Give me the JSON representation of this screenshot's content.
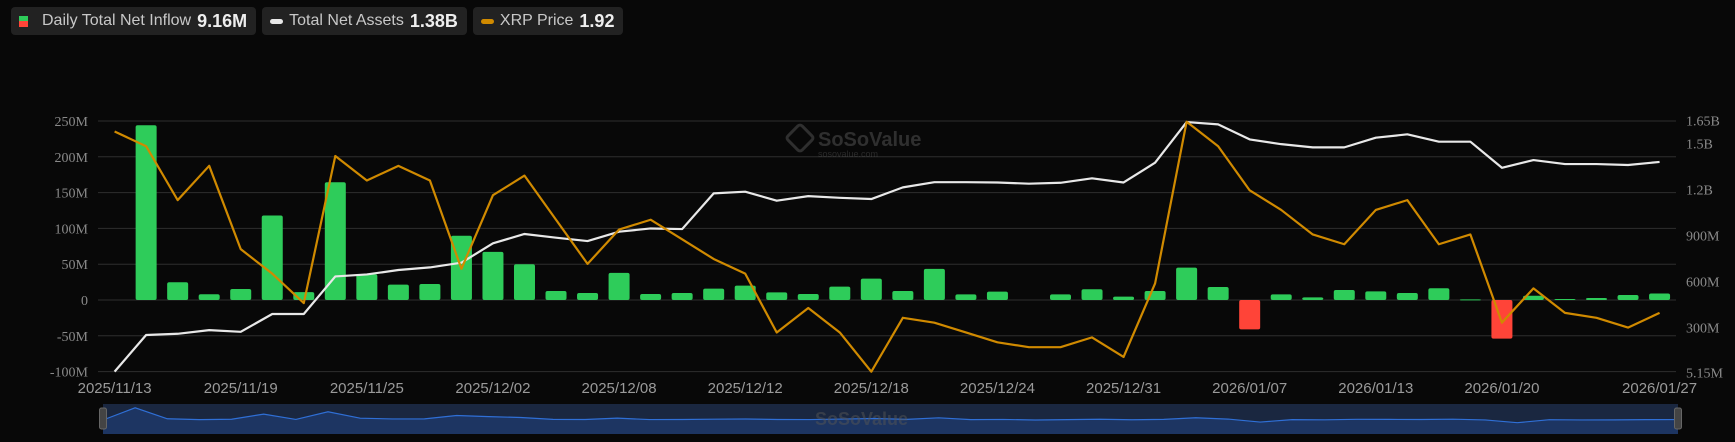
{
  "legend": [
    {
      "label": "Daily Total Net Inflow",
      "value": "9.16M",
      "color_up": "#2ecc5a",
      "color_down": "#ff4438"
    },
    {
      "label": "Total Net Assets",
      "value": "1.38B",
      "color": "#e8e8e8"
    },
    {
      "label": "XRP Price",
      "value": "1.92",
      "color": "#d08a00"
    }
  ],
  "watermark": {
    "brand": "SoSoValue",
    "url": "sosovalue.com"
  },
  "chart_data": {
    "type": "bar+line",
    "x": [
      "2025/11/13",
      "2025/11/14",
      "2025/11/17",
      "2025/11/18",
      "2025/11/19",
      "2025/11/20",
      "2025/11/21",
      "2025/11/24",
      "2025/11/25",
      "2025/11/26",
      "2025/11/28",
      "2025/12/01",
      "2025/12/02",
      "2025/12/03",
      "2025/12/04",
      "2025/12/05",
      "2025/12/08",
      "2025/12/09",
      "2025/12/10",
      "2025/12/11",
      "2025/12/12",
      "2025/12/15",
      "2025/12/16",
      "2025/12/17",
      "2025/12/18",
      "2025/12/19",
      "2025/12/22",
      "2025/12/23",
      "2025/12/24",
      "2025/12/26",
      "2025/12/29",
      "2025/12/30",
      "2025/12/31",
      "2026/01/02",
      "2026/01/05",
      "2026/01/06",
      "2026/01/07",
      "2026/01/08",
      "2026/01/09",
      "2026/01/12",
      "2026/01/13",
      "2026/01/14",
      "2026/01/15",
      "2026/01/16",
      "2026/01/20",
      "2026/01/21",
      "2026/01/22",
      "2026/01/23",
      "2026/01/26",
      "2026/01/27"
    ],
    "x_tick_labels": [
      "2025/11/13",
      "2025/11/19",
      "2025/11/25",
      "2025/12/02",
      "2025/12/08",
      "2025/12/12",
      "2025/12/18",
      "2025/12/24",
      "2025/12/31",
      "2026/01/07",
      "2026/01/13",
      "2026/01/20",
      "2026/01/27"
    ],
    "series": [
      {
        "name": "Daily Total Net Inflow",
        "type": "bar",
        "axis": "left",
        "unit": "M USD",
        "values": [
          0,
          244,
          24.8,
          8,
          15.4,
          118,
          11,
          164.5,
          36,
          21.5,
          22.4,
          89.7,
          67.3,
          50,
          12.6,
          9.8,
          37.9,
          8.4,
          9.8,
          15.9,
          20.1,
          10.7,
          8.4,
          18.7,
          29.9,
          12.6,
          43.5,
          7.9,
          11.7,
          0,
          7.9,
          15,
          4.7,
          12.6,
          45.3,
          18.2,
          -41,
          7.9,
          3.7,
          14,
          12.1,
          9.8,
          16.4,
          0.9,
          -54,
          6,
          1.4,
          2.8,
          7,
          9.16
        ]
      },
      {
        "name": "Total Net Assets",
        "type": "line",
        "axis": "right",
        "unit": "M USD",
        "values": [
          12,
          251,
          259,
          283,
          272,
          388,
          388,
          633,
          646,
          675,
          692,
          723,
          849,
          910,
          886,
          864,
          925,
          946,
          942,
          1175,
          1186,
          1127,
          1157,
          1146,
          1138,
          1214,
          1248,
          1248,
          1246,
          1238,
          1244,
          1273,
          1246,
          1375,
          1640,
          1625,
          1527,
          1496,
          1475,
          1475,
          1538,
          1560,
          1512,
          1512,
          1342,
          1392,
          1366,
          1366,
          1360,
          1380
        ]
      },
      {
        "name": "XRP Price",
        "type": "line",
        "axis": "hidden",
        "unit": "USD",
        "values": [
          2.29,
          2.26,
          2.15,
          2.22,
          2.05,
          2.0,
          1.94,
          2.24,
          2.19,
          2.22,
          2.19,
          2.01,
          2.16,
          2.2,
          2.11,
          2.02,
          2.09,
          2.11,
          2.07,
          2.03,
          2.0,
          1.88,
          1.93,
          1.88,
          1.8,
          1.91,
          1.9,
          1.88,
          1.86,
          1.85,
          1.85,
          1.87,
          1.83,
          1.98,
          2.31,
          2.26,
          2.17,
          2.13,
          2.08,
          2.06,
          2.13,
          2.15,
          2.06,
          2.08,
          1.9,
          1.97,
          1.92,
          1.91,
          1.89,
          1.92
        ]
      }
    ],
    "left_axis": {
      "range": [
        -100,
        250
      ],
      "ticks": [
        250,
        200,
        150,
        100,
        50,
        0,
        -50,
        -100
      ],
      "tick_labels": [
        "250M",
        "200M",
        "150M",
        "100M",
        "50M",
        "0",
        "-50M",
        "-100M"
      ]
    },
    "right_axis": {
      "range": [
        5.15,
        1650
      ],
      "ticks": [
        1650,
        1500,
        1200,
        900,
        600,
        300,
        5.15
      ],
      "tick_labels": [
        "1.65B",
        "1.5B",
        "1.2B",
        "900M",
        "600M",
        "300M",
        "5.15M"
      ]
    },
    "price_axis_range": [
      1.8,
      2.31
    ],
    "grid": true,
    "legend_position": "top-left",
    "navigator": true
  }
}
